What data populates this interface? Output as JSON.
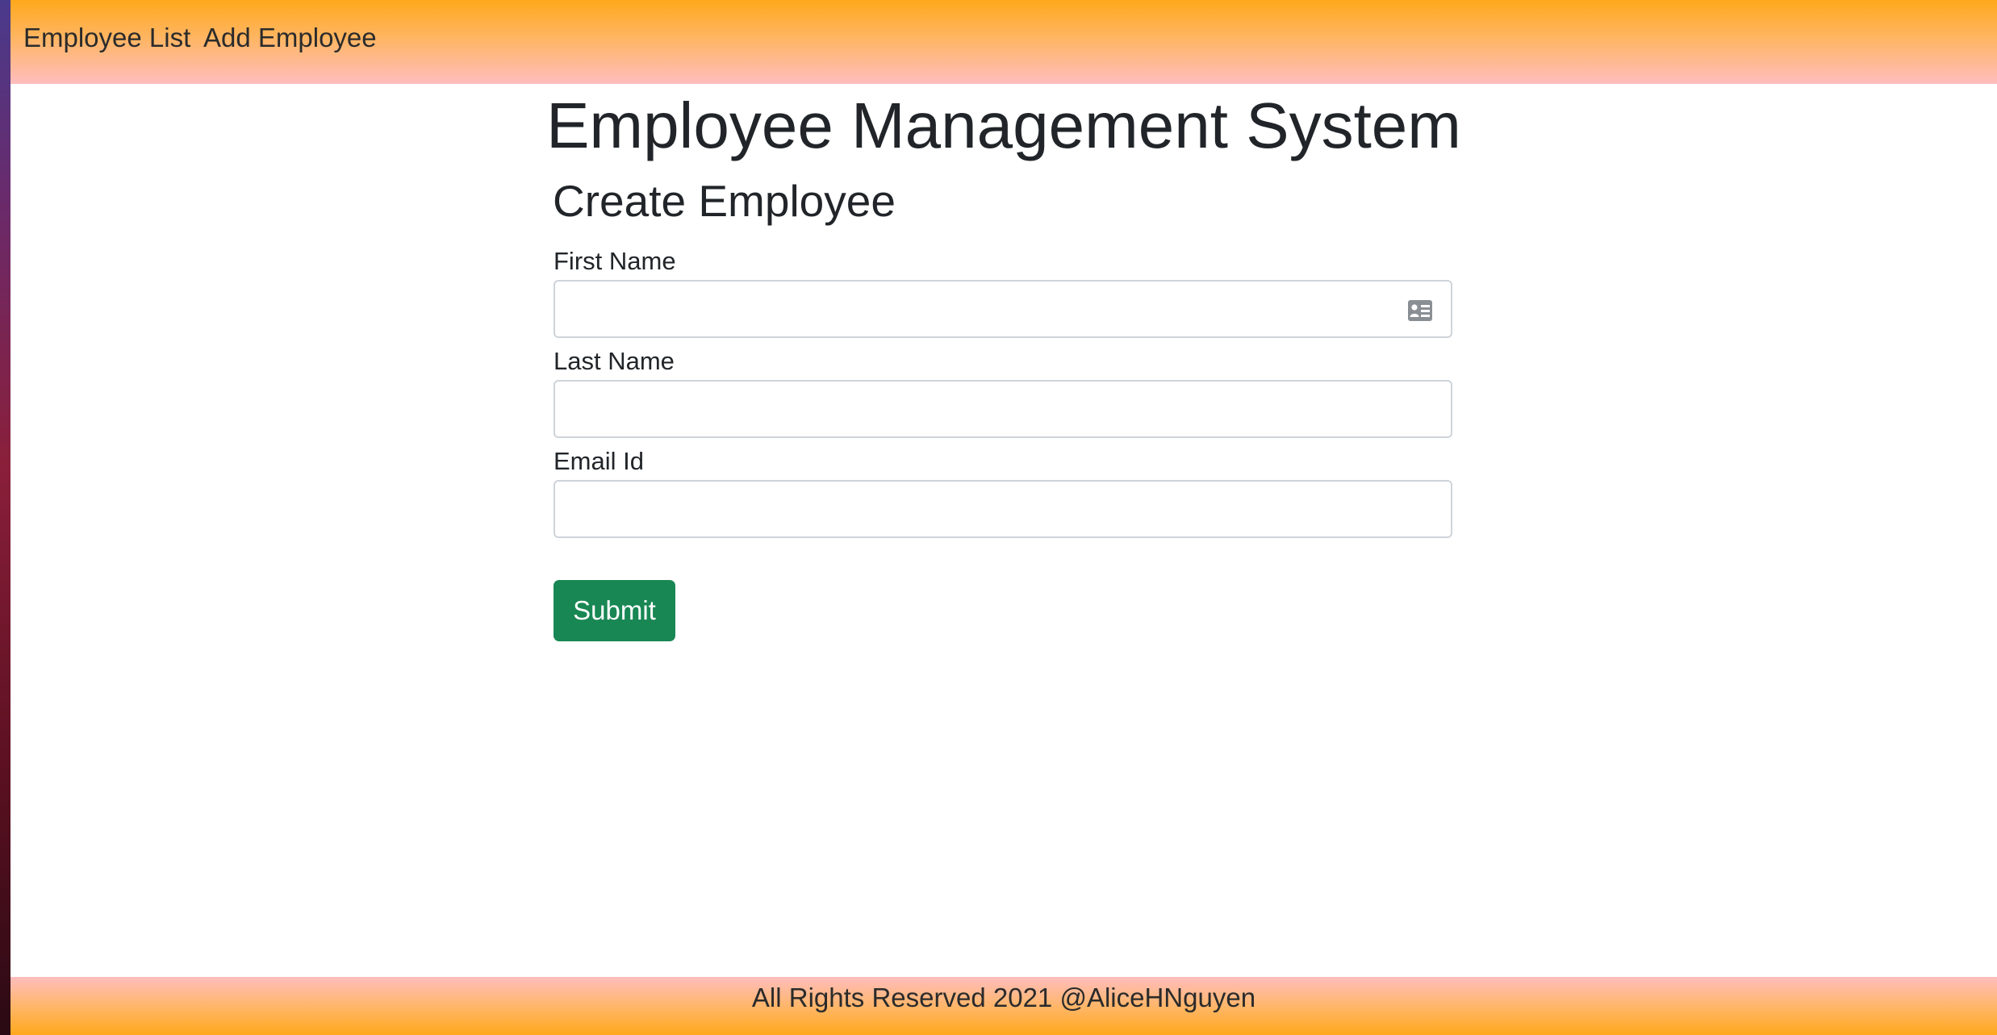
{
  "colors": {
    "header_gradient_top": "#ffa81c",
    "header_gradient_bottom": "#ffbdbd",
    "submit_button": "#198754",
    "text": "#212529"
  },
  "nav": {
    "items": [
      {
        "label": "Employee List"
      },
      {
        "label": "Add Employee"
      }
    ]
  },
  "page": {
    "title": "Employee Management System"
  },
  "form": {
    "title": "Create Employee",
    "fields": [
      {
        "label": "First Name",
        "value": "",
        "icon": "contact-card-icon"
      },
      {
        "label": "Last Name",
        "value": ""
      },
      {
        "label": "Email Id",
        "value": ""
      }
    ],
    "submit_label": "Submit"
  },
  "footer": {
    "text": "All Rights Reserved 2021 @AliceHNguyen"
  }
}
